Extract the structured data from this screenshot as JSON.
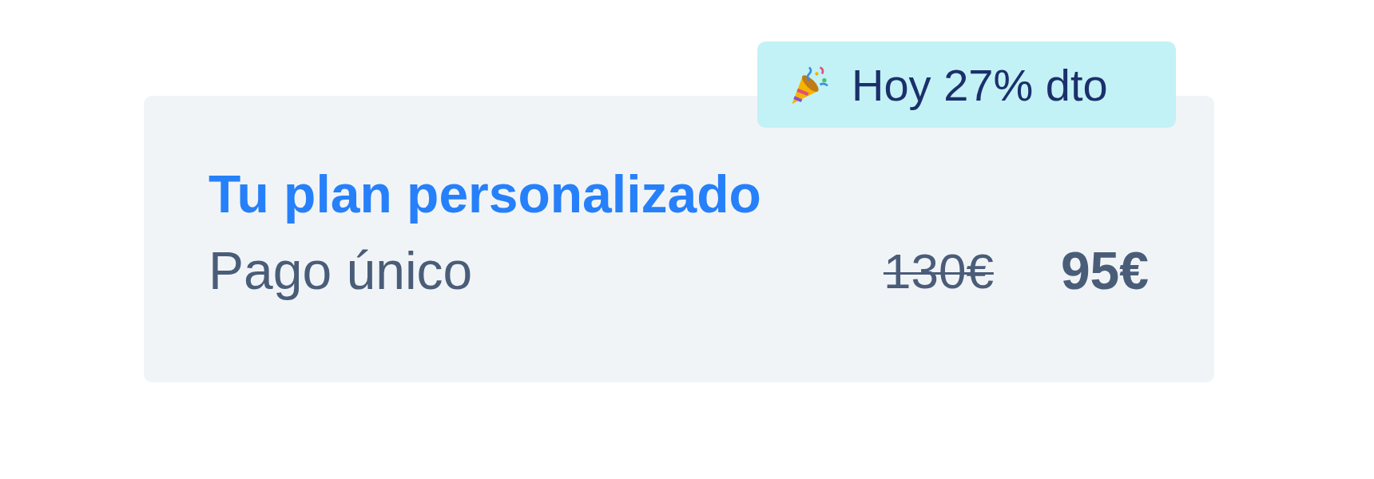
{
  "badge": {
    "text": "Hoy 27% dto"
  },
  "plan": {
    "title": "Tu plan personalizado",
    "label": "Pago único",
    "old_price": "130€",
    "price": "95€"
  }
}
